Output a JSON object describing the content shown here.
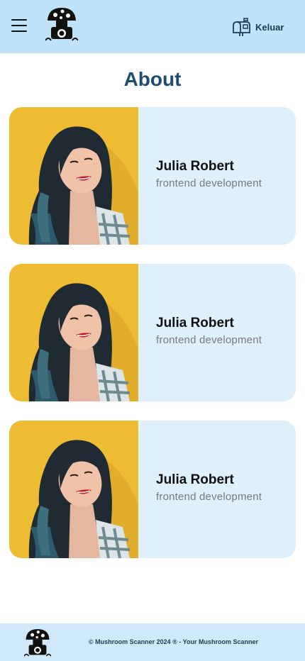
{
  "header": {
    "menu_icon": "hamburger-menu-icon",
    "logo_icon": "mushroom-camera-logo",
    "logout_icon": "mailbox-icon",
    "logout_label": "Keluar"
  },
  "page": {
    "title": "About"
  },
  "team": [
    {
      "name": "Julia Robert",
      "role": "frontend development"
    },
    {
      "name": "Julia Robert",
      "role": "frontend development"
    },
    {
      "name": "Julia Robert",
      "role": "frontend development"
    }
  ],
  "footer": {
    "logo_icon": "mushroom-camera-logo",
    "copyright": "© Mushroom Scanner 2024 ® - Your Mushroom Scanner"
  },
  "colors": {
    "header_bg": "#bfe3f8",
    "card_bg": "#ddf0fb",
    "title": "#1b4d72",
    "photo_bg": "#f2c037"
  }
}
